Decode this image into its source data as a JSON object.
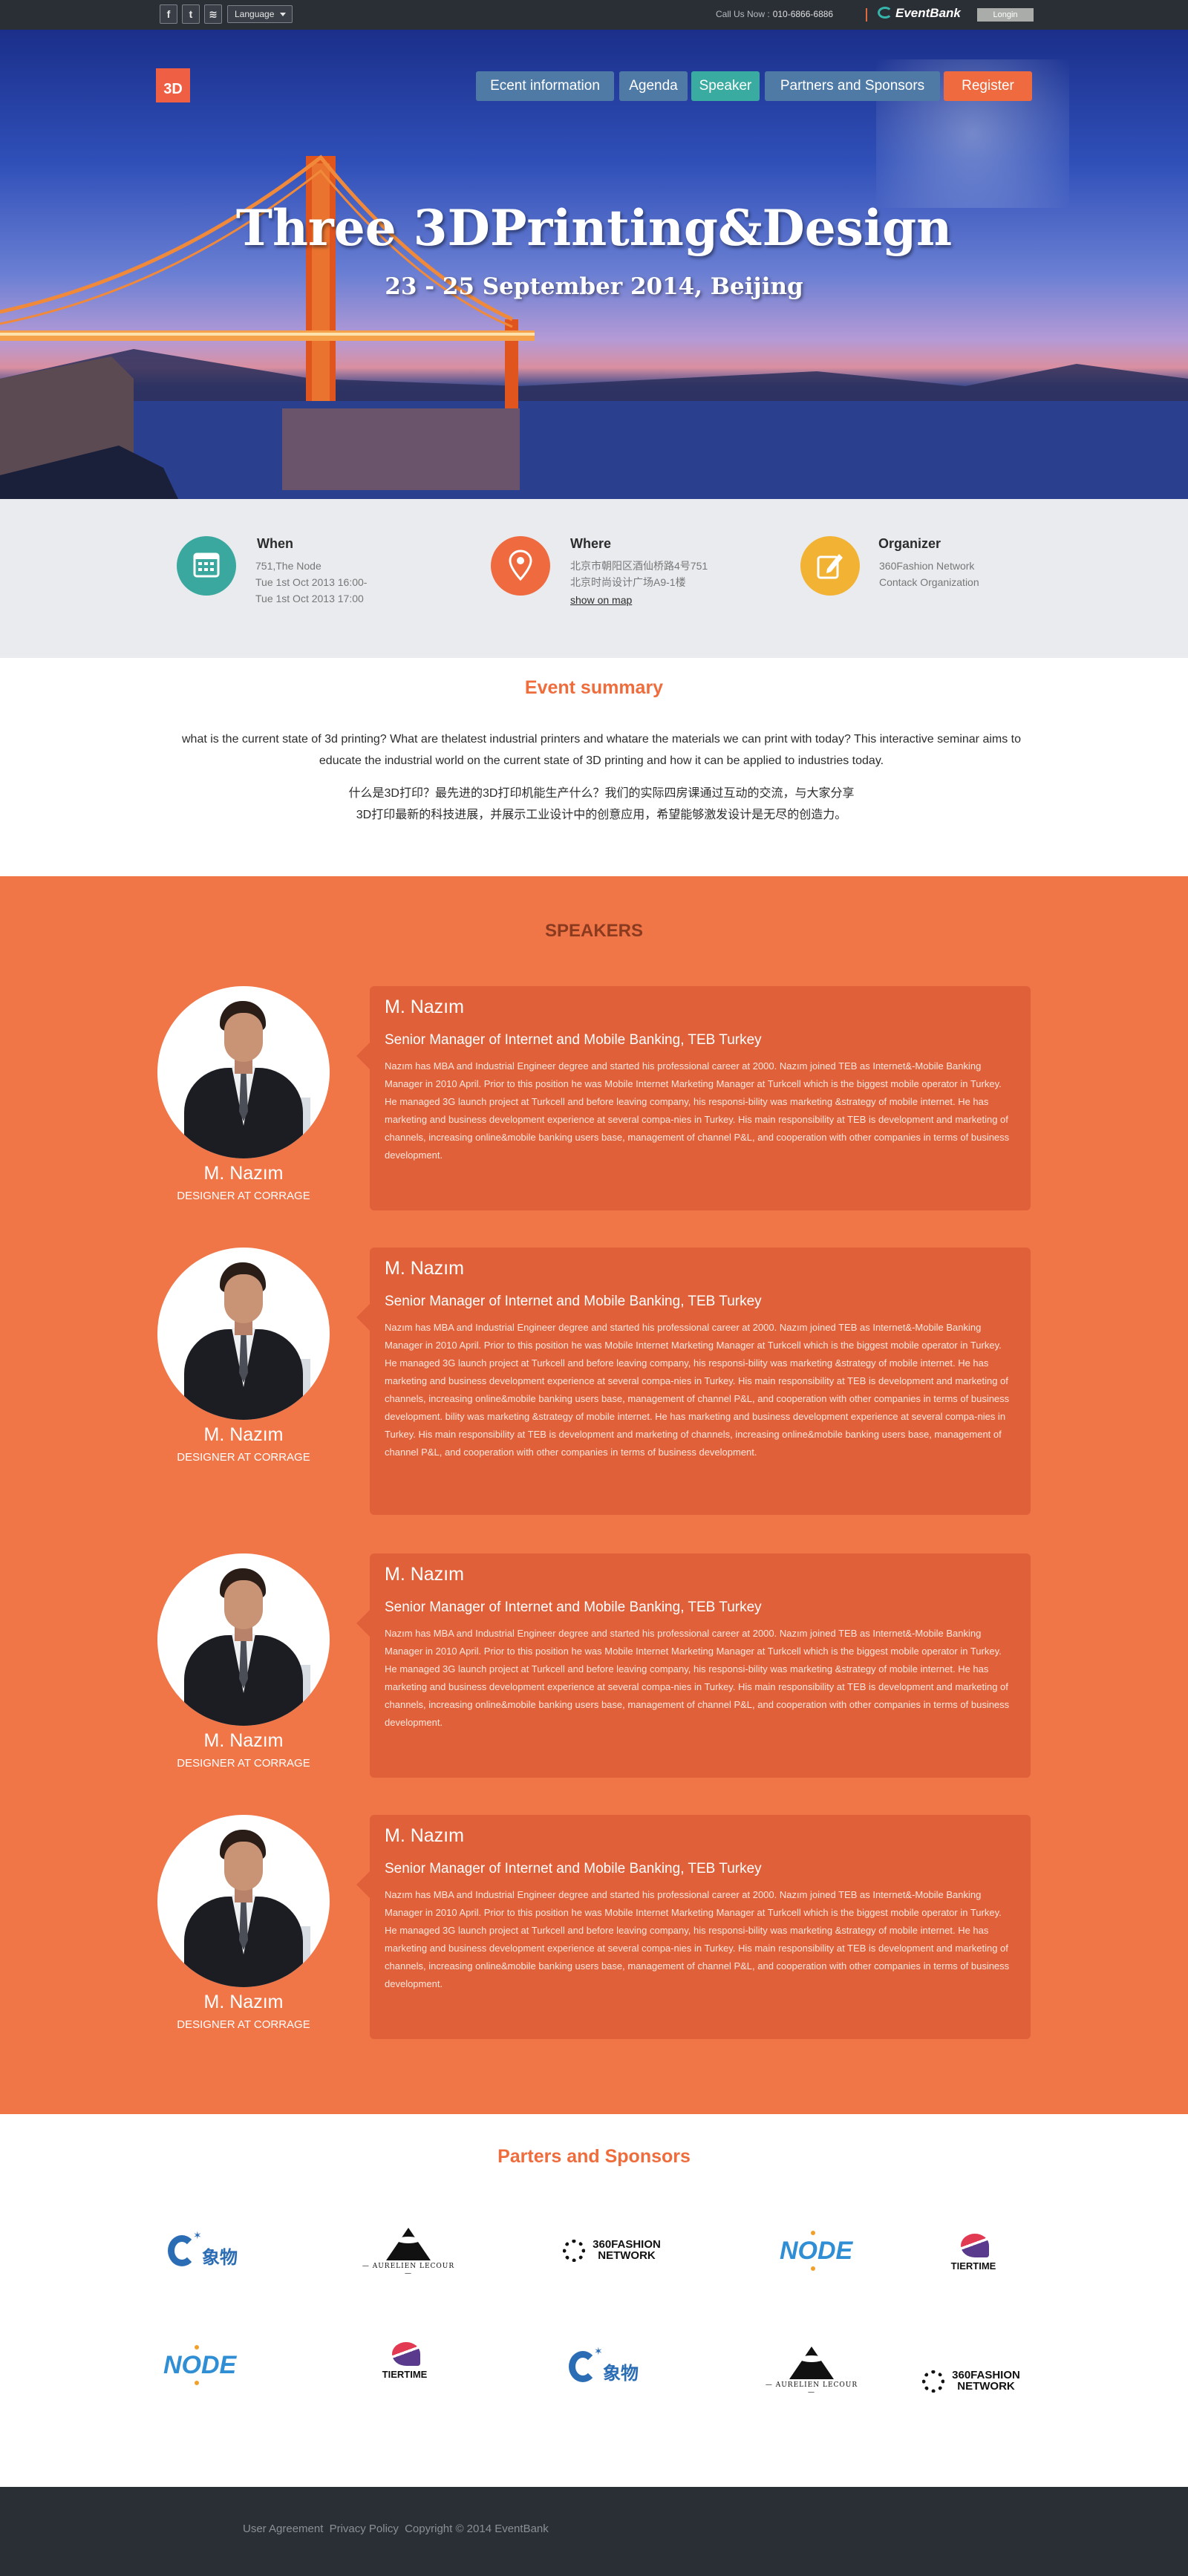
{
  "topbar": {
    "social_icons": [
      {
        "name": "facebook-icon",
        "glyph": "f"
      },
      {
        "name": "twitter-icon",
        "glyph": "t"
      },
      {
        "name": "rss-icon",
        "glyph": "≋"
      }
    ],
    "language": "Language",
    "call_label": "Call Us Now :",
    "phone": "010-6866-6886",
    "brand": "EventBank",
    "login": "Longin"
  },
  "hero": {
    "logo": "3D",
    "nav": [
      {
        "label": "Ecent information",
        "color": "#4f7aa6"
      },
      {
        "label": "Agenda",
        "color": "#4f7aa6"
      },
      {
        "label": "Speaker",
        "color": "#3aaba0"
      },
      {
        "label": "Partners and Sponsors",
        "color": "#4f7aa6"
      },
      {
        "label": "Register",
        "color": "#ef6a3e"
      }
    ],
    "title": "Three 3DPrinting&Design",
    "subtitle": "23 - 25 September 2014, Beijing"
  },
  "info": {
    "when": {
      "title": "When",
      "lines": [
        "751,The Node",
        "Tue 1st Oct 2013 16:00-",
        "Tue 1st Oct 2013 17:00"
      ],
      "color": "#3aa89e"
    },
    "where": {
      "title": "Where",
      "lines": [
        "北京市朝阳区酒仙桥路4号751",
        "北京时尚设计广场A9-1楼"
      ],
      "link": "show on map",
      "color": "#ef6a3e"
    },
    "organizer": {
      "title": "Organizer",
      "lines": [
        "360Fashion Network",
        "Contack Organization"
      ],
      "color": "#f2b233"
    }
  },
  "summary": {
    "title": "Event summary",
    "english": "what is the current state of 3d printing? What are thelatest industrial printers and whatare the materials we can print with today? This interactive seminar aims to educate the industrial world on the current state of 3D printing and how it can be applied to industries today.",
    "chinese_line1": "什么是3D打印？最先进的3D打印机能生产什么？我们的实际四房课通过互动的交流，与大家分享",
    "chinese_line2": "3D打印最新的科技进展，并展示工业设计中的创意应用，希望能够激发设计是无尽的创造力。"
  },
  "speakers": {
    "title": "SPEAKERS",
    "items": [
      {
        "name": "M. Nazım",
        "role": "DESIGNER AT CORRAGE",
        "position": "Senior Manager of Internet and Mobile Banking, TEB Turkey",
        "bio": "Nazım has MBA and Industrial Engineer degree and started his professional career at 2000. Nazım joined TEB as Internet&-Mobile Banking Manager in 2010 April. Prior to this position he was Mobile Internet Marketing Manager at Turkcell which is the biggest mobile operator in Turkey. He managed 3G launch project at Turkcell and before leaving company, his responsi-bility was marketing &strategy of mobile internet. He has marketing and business development experience at several compa-nies in Turkey. His main responsibility at TEB is development and marketing of channels, increasing online&mobile banking users base, management of channel P&L, and cooperation with other companies in terms of business development."
      },
      {
        "name": "M. Nazım",
        "role": "DESIGNER AT CORRAGE",
        "position": "Senior Manager of Internet and Mobile Banking, TEB Turkey",
        "bio": "Nazım has MBA and Industrial Engineer degree and started his professional career at 2000. Nazım joined TEB as Internet&-Mobile Banking Manager in 2010 April. Prior to this position he was Mobile Internet Marketing Manager at Turkcell which is the biggest mobile operator in Turkey. He managed 3G launch project at Turkcell and before leaving company, his responsi-bility was marketing &strategy of mobile internet. He has marketing and business development experience at several compa-nies in Turkey. His main responsibility at TEB is development and marketing of channels, increasing online&mobile banking users base, management of channel P&L, and cooperation with other companies in terms of business development. bility was marketing &strategy of mobile internet. He has marketing and business development experience at several compa-nies in Turkey. His main responsibility at TEB is development and marketing of channels, increasing online&mobile banking users base, management of channel P&L, and cooperation with other companies in terms of business development."
      },
      {
        "name": "M. Nazım",
        "role": "DESIGNER AT CORRAGE",
        "position": "Senior Manager of Internet and Mobile Banking, TEB Turkey",
        "bio": "Nazım has MBA and Industrial Engineer degree and started his professional career at 2000. Nazım joined TEB as Internet&-Mobile Banking Manager in 2010 April. Prior to this position he was Mobile Internet Marketing Manager at Turkcell which is the biggest mobile operator in Turkey. He managed 3G launch project at Turkcell and before leaving company, his responsi-bility was marketing &strategy of mobile internet. He has marketing and business development experience at several compa-nies in Turkey. His main responsibility at TEB is development and marketing of channels, increasing online&mobile banking users base, management of channel P&L, and cooperation with other companies in terms of business development."
      },
      {
        "name": "M. Nazım",
        "role": "DESIGNER AT CORRAGE",
        "position": "Senior Manager of Internet and Mobile Banking, TEB Turkey",
        "bio": "Nazım has MBA and Industrial Engineer degree and started his professional career at 2000. Nazım joined TEB as Internet&-Mobile Banking Manager in 2010 April. Prior to this position he was Mobile Internet Marketing Manager at Turkcell which is the biggest mobile operator in Turkey. He managed 3G launch project at Turkcell and before leaving company, his responsi-bility was marketing &strategy of mobile internet. He has marketing and business development experience at several compa-nies in Turkey. His main responsibility at TEB is development and marketing of channels, increasing online&mobile banking users base, management of channel P&L, and cooperation with other companies in terms of business development."
      }
    ]
  },
  "sponsors": {
    "title": "Parters and Sponsors",
    "logos": [
      {
        "kind": "xiangwu",
        "text": "象物"
      },
      {
        "kind": "aurelien",
        "text": "— AURELIEN LECOUR —"
      },
      {
        "kind": "fashion",
        "text": "360FASHION NETWORK"
      },
      {
        "kind": "node",
        "text": "NODE"
      },
      {
        "kind": "tiertime",
        "text": "TIERTIME"
      },
      {
        "kind": "node",
        "text": "NODE"
      },
      {
        "kind": "tiertime",
        "text": "TIERTIME"
      },
      {
        "kind": "xiangwu",
        "text": "象物"
      },
      {
        "kind": "aurelien",
        "text": "— AURELIEN LECOUR —"
      },
      {
        "kind": "fashion",
        "text": "360FASHION NETWORK"
      }
    ]
  },
  "footer": {
    "links": [
      "User Agreement",
      "Privacy Policy",
      "Copyright © 2014 EventBank"
    ]
  }
}
